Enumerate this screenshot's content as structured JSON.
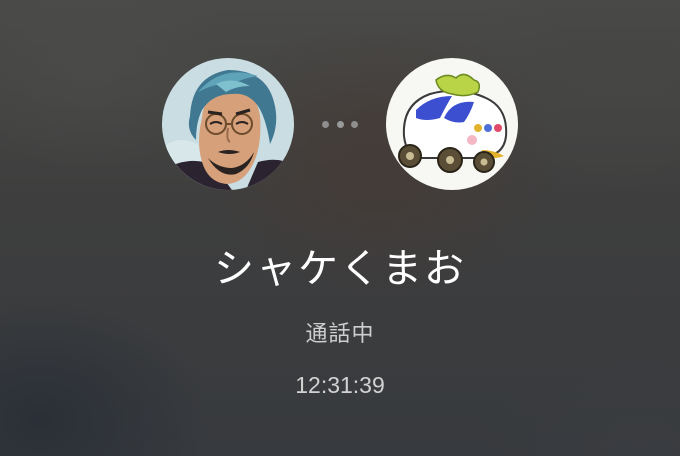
{
  "call": {
    "contact_name": "シャケくまお",
    "status": "通話中",
    "duration": "12:31:39"
  },
  "avatars": {
    "left": {
      "icon": "user-avatar-illustration"
    },
    "right": {
      "icon": "contact-avatar-illustration"
    }
  },
  "connecting_indicator": {
    "dots": 3
  },
  "colors": {
    "background": "#3c3c3c",
    "name_text": "#ffffff",
    "status_text": "#cfcfcf",
    "dots": "#8e8e8e"
  }
}
